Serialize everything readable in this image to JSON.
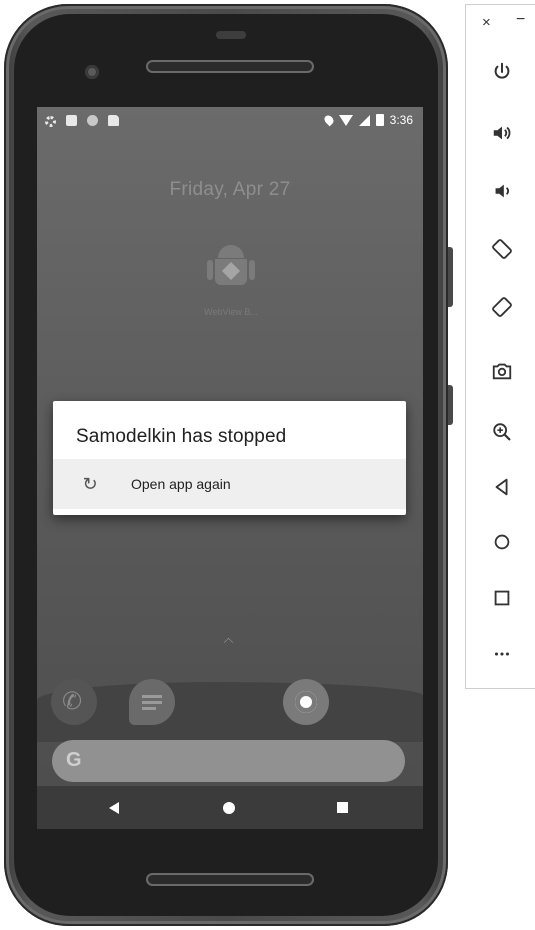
{
  "status_bar": {
    "time": "3:36"
  },
  "home": {
    "date": "Friday, Apr 27",
    "app_label": "WebView B..."
  },
  "dialog": {
    "title": "Samodelkin has stopped",
    "action_label": "Open app again"
  },
  "toolbar": {
    "close_glyph": "×",
    "minimize_glyph": "−",
    "buttons": [
      {
        "icon": "power-icon"
      },
      {
        "icon": "volume-up-icon"
      },
      {
        "icon": "volume-down-icon"
      },
      {
        "icon": "rotate-left-icon"
      },
      {
        "icon": "rotate-right-icon"
      },
      {
        "icon": "camera-icon"
      },
      {
        "icon": "zoom-in-icon"
      },
      {
        "icon": "back-icon"
      },
      {
        "icon": "home-icon"
      },
      {
        "icon": "overview-icon"
      },
      {
        "icon": "more-icon"
      }
    ]
  }
}
